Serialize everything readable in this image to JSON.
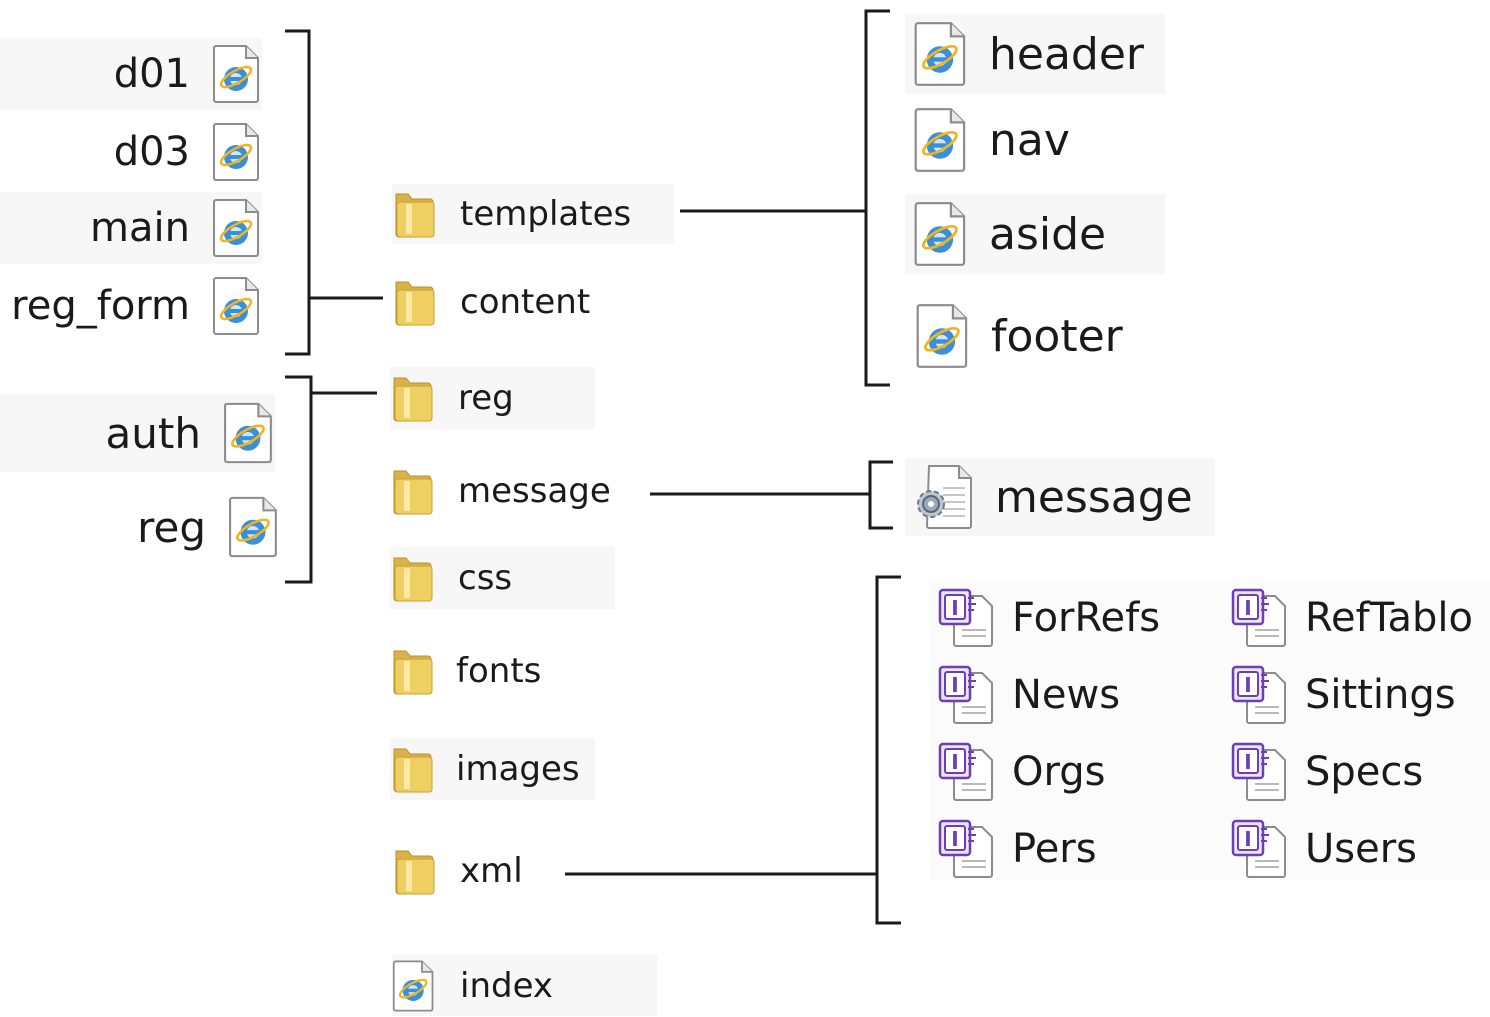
{
  "colors": {
    "line": "#1a1a1a",
    "folder": "#f0cf62",
    "ie_blue": "#3a8fd8",
    "ie_ring": "#f2b41c",
    "xml_purple": "#6a3fb8"
  },
  "icons": {
    "folder": "folder-icon",
    "html": "ie-document-icon",
    "config": "gear-document-icon",
    "xml": "xml-document-icon"
  },
  "content_files": [
    "d01",
    "d03",
    "main",
    "reg_form"
  ],
  "reg_files": [
    "auth",
    "reg"
  ],
  "folders": [
    "templates",
    "content",
    "reg",
    "message",
    "css",
    "fonts",
    "images",
    "xml"
  ],
  "root_file": "index",
  "template_files": [
    "header",
    "nav",
    "aside",
    "footer"
  ],
  "message_file": "message",
  "xml_files": {
    "col1": [
      "ForRefs",
      "News",
      "Orgs",
      "Pers"
    ],
    "col2": [
      "RefTablo",
      "Sittings",
      "Specs",
      "Users"
    ]
  }
}
